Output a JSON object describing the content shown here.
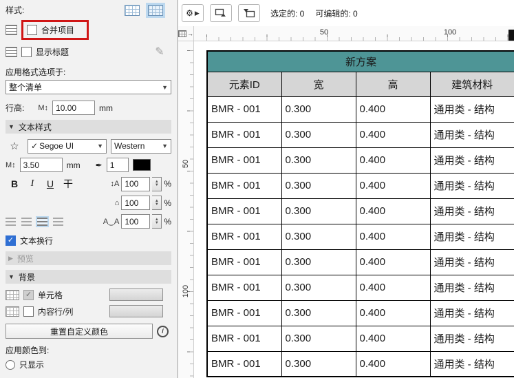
{
  "left_panel": {
    "style_label": "样式:",
    "merge_items_label": "合并项目",
    "show_title_label": "显示标题",
    "apply_format_label": "应用格式选项于:",
    "scope_value": "整个清单",
    "row_height": {
      "label": "行高:",
      "value": "10.00",
      "unit": "mm"
    },
    "sections": {
      "text_style": "文本样式",
      "preview": "预览",
      "background": "背景"
    },
    "font": {
      "check": "✓",
      "name": "Segoe UI",
      "script": "Western"
    },
    "size": {
      "value": "3.50",
      "unit": "mm"
    },
    "pen": {
      "value": "1"
    },
    "format_buttons": {
      "bold": "B",
      "italic": "I",
      "underline": "U",
      "strike": "干"
    },
    "spacing": [
      {
        "value": "100",
        "unit": "%"
      },
      {
        "value": "100",
        "unit": "%"
      },
      {
        "value": "100",
        "unit": "%"
      }
    ],
    "text_wrap_label": "文本换行",
    "background_rows": {
      "cell": "单元格",
      "content": "内容行/列"
    },
    "reset_button_label": "重置自定义颜色",
    "info_glyph": "i",
    "apply_color_label": "应用颜色到:",
    "bottom_radio_label": "只显示"
  },
  "toolbar": {
    "selected": "选定的: 0",
    "editable": "可编辑的: 0"
  },
  "rulers": {
    "h": [
      "50",
      "100"
    ],
    "v": [
      "50",
      "100"
    ]
  },
  "table": {
    "title": "新方案",
    "columns": [
      "元素ID",
      "宽",
      "高",
      "建筑材料"
    ],
    "rows": [
      [
        "BMR - 001",
        "0.300",
        "0.400",
        "通用类 - 结构"
      ],
      [
        "BMR - 001",
        "0.300",
        "0.400",
        "通用类 - 结构"
      ],
      [
        "BMR - 001",
        "0.300",
        "0.400",
        "通用类 - 结构"
      ],
      [
        "BMR - 001",
        "0.300",
        "0.400",
        "通用类 - 结构"
      ],
      [
        "BMR - 001",
        "0.300",
        "0.400",
        "通用类 - 结构"
      ],
      [
        "BMR - 001",
        "0.300",
        "0.400",
        "通用类 - 结构"
      ],
      [
        "BMR - 001",
        "0.300",
        "0.400",
        "通用类 - 结构"
      ],
      [
        "BMR - 001",
        "0.300",
        "0.400",
        "通用类 - 结构"
      ],
      [
        "BMR - 001",
        "0.300",
        "0.400",
        "通用类 - 结构"
      ],
      [
        "BMR - 001",
        "0.300",
        "0.400",
        "通用类 - 结构"
      ],
      [
        "BMR - 001",
        "0.300",
        "0.400",
        "通用类 - 结构"
      ]
    ]
  },
  "colors": {
    "table_header_teal": "#4e9596",
    "column_header_grey": "#d6d6d6",
    "highlight_red": "#d01616",
    "accent_blue": "#2f6fd3"
  }
}
